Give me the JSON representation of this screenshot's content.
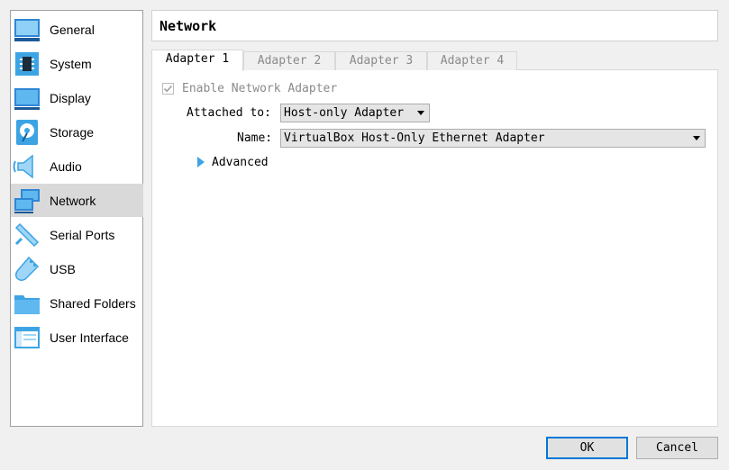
{
  "sidebar": {
    "items": [
      {
        "label": "General",
        "icon": "general-icon"
      },
      {
        "label": "System",
        "icon": "system-chip-icon"
      },
      {
        "label": "Display",
        "icon": "display-monitor-icon"
      },
      {
        "label": "Storage",
        "icon": "storage-disk-icon"
      },
      {
        "label": "Audio",
        "icon": "audio-speaker-icon"
      },
      {
        "label": "Network",
        "icon": "network-icon",
        "selected": true
      },
      {
        "label": "Serial Ports",
        "icon": "serial-port-icon"
      },
      {
        "label": "USB",
        "icon": "usb-icon"
      },
      {
        "label": "Shared Folders",
        "icon": "shared-folder-icon"
      },
      {
        "label": "User Interface",
        "icon": "user-interface-icon"
      }
    ]
  },
  "page": {
    "title": "Network"
  },
  "tabs": [
    {
      "label": "Adapter 1",
      "active": true
    },
    {
      "label": "Adapter 2"
    },
    {
      "label": "Adapter 3"
    },
    {
      "label": "Adapter 4"
    }
  ],
  "adapter": {
    "enable_label": "Enable Network Adapter",
    "enabled": true,
    "attached_label": "Attached to:",
    "attached_value": "Host-only Adapter",
    "name_label": "Name:",
    "name_value": "VirtualBox Host-Only Ethernet Adapter",
    "advanced_label": "Advanced"
  },
  "buttons": {
    "ok": "OK",
    "cancel": "Cancel"
  },
  "colors": {
    "accent": "#0078d7",
    "icon_blue": "#3da4e4",
    "selected_bg": "#d9d9d9"
  }
}
